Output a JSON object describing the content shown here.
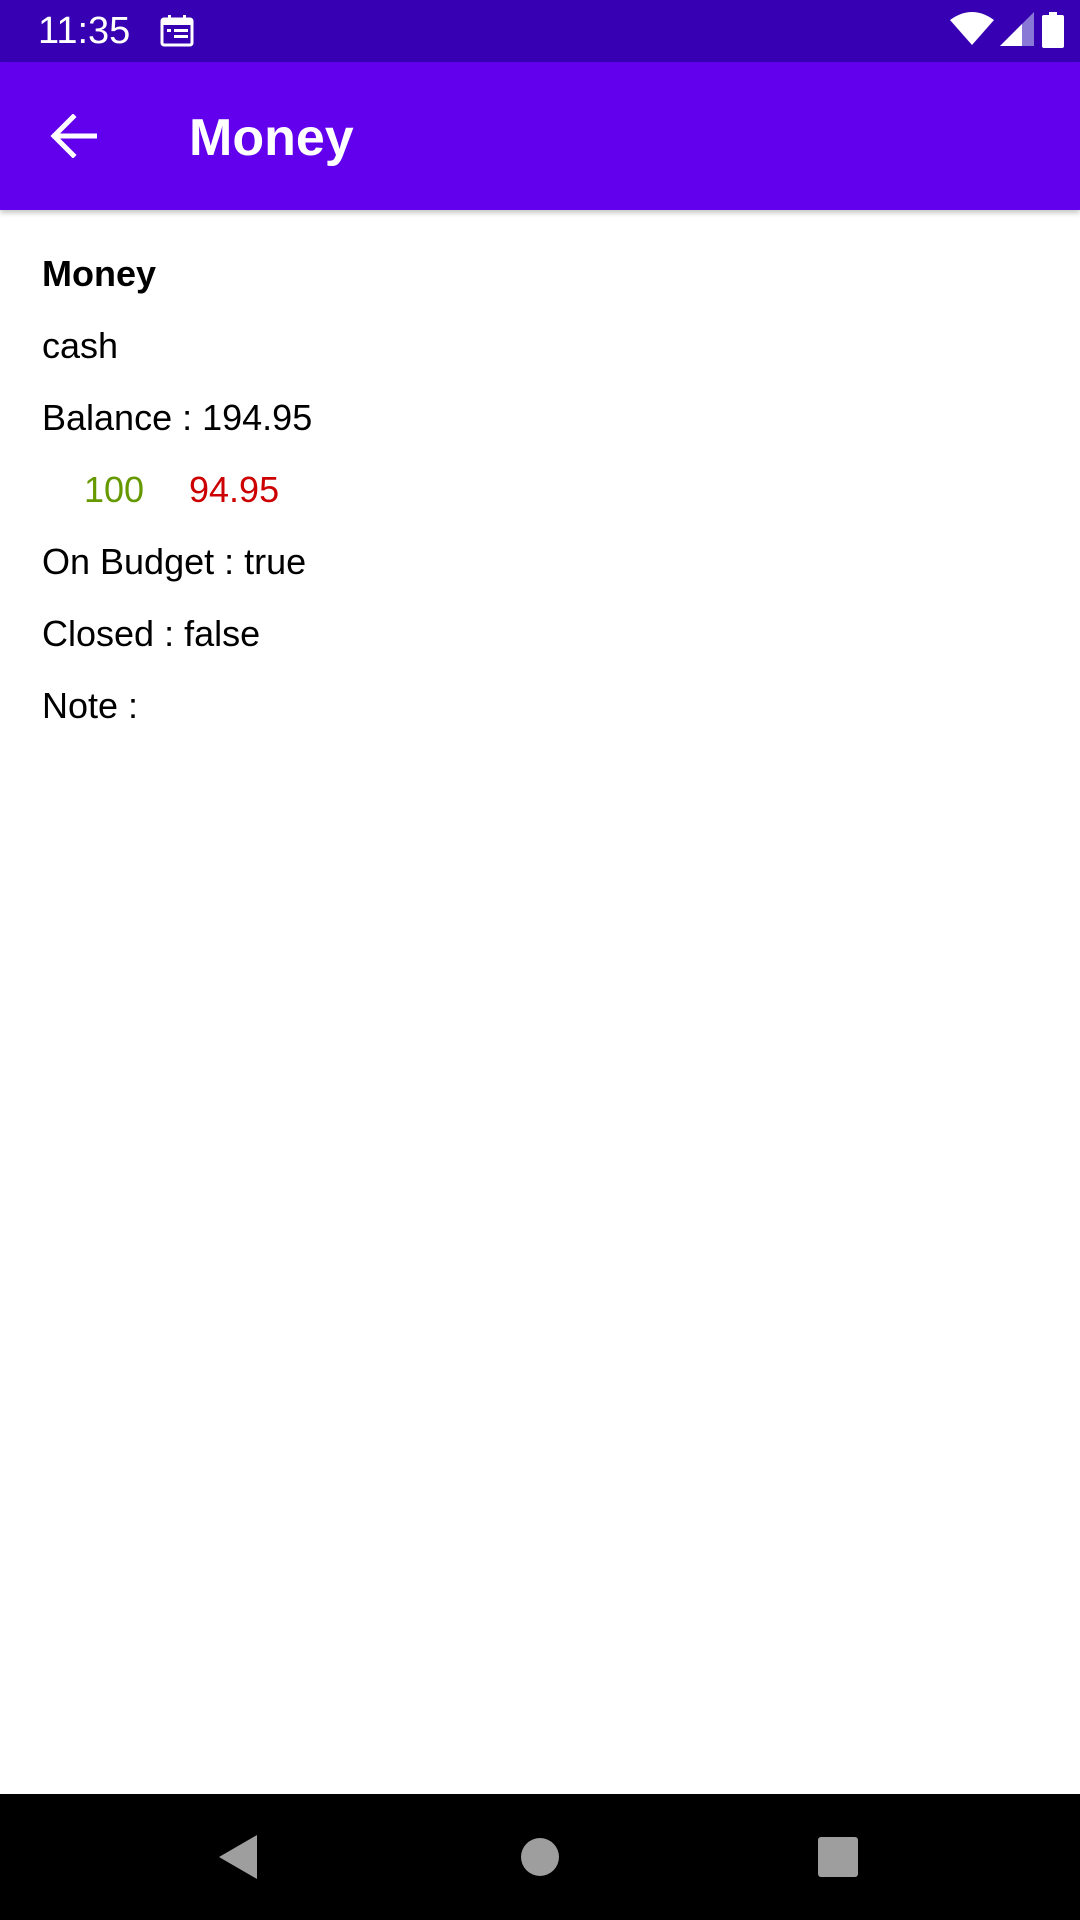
{
  "status_bar": {
    "time": "11:35",
    "icons": [
      "calendar-icon",
      "wifi-icon",
      "signal-icon",
      "battery-icon"
    ]
  },
  "app_bar": {
    "title": "Money",
    "back_icon": "arrow-back-icon",
    "background": "#6200ee"
  },
  "account": {
    "name": "Money",
    "type": "cash",
    "balance": "Balance : 194.95",
    "positive_amount": "100",
    "negative_amount": "94.95",
    "on_budget": "On Budget : true",
    "closed": "Closed : false",
    "note": "Note :"
  },
  "colors": {
    "status_bar": "#3700b3",
    "positive": "#669900",
    "negative": "#cc0000"
  },
  "nav_bar": {
    "buttons": [
      "back-nav-icon",
      "home-nav-icon",
      "recents-nav-icon"
    ]
  }
}
